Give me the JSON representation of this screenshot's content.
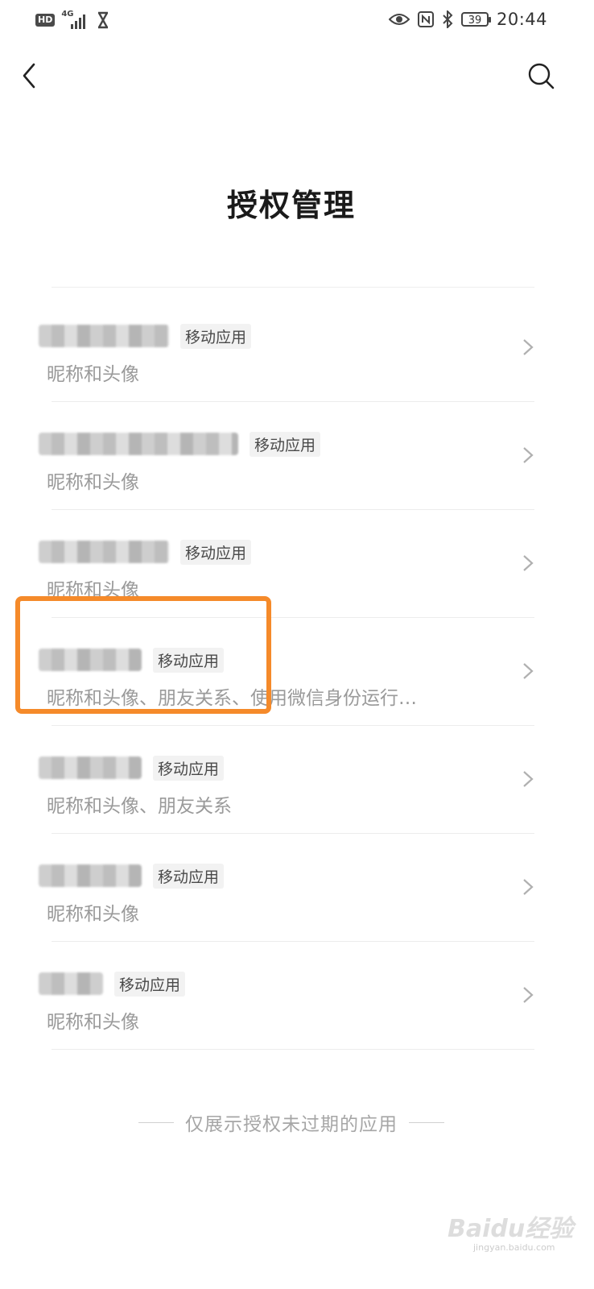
{
  "status_bar": {
    "hd": "HD",
    "network": "4G",
    "battery": "39",
    "time": "20:44"
  },
  "header": {
    "back_icon": "chevron-left-icon",
    "search_icon": "search-icon"
  },
  "page": {
    "title": "授权管理"
  },
  "apps": [
    {
      "tag": "移动应用",
      "permissions": "昵称和头像"
    },
    {
      "tag": "移动应用",
      "permissions": "昵称和头像"
    },
    {
      "tag": "移动应用",
      "permissions": "昵称和头像"
    },
    {
      "tag": "移动应用",
      "permissions": "昵称和头像、朋友关系、使用微信身份运行…",
      "highlighted": true
    },
    {
      "tag": "移动应用",
      "permissions": "昵称和头像、朋友关系"
    },
    {
      "tag": "移动应用",
      "permissions": "昵称和头像"
    },
    {
      "tag": "移动应用",
      "permissions": "昵称和头像"
    }
  ],
  "footer": {
    "note": "仅展示授权未过期的应用"
  },
  "watermark": {
    "logo": "Baidu经验",
    "url": "jingyan.baidu.com"
  },
  "colors": {
    "highlight": "#f58a2a",
    "secondary_text": "#9a9a9a"
  }
}
